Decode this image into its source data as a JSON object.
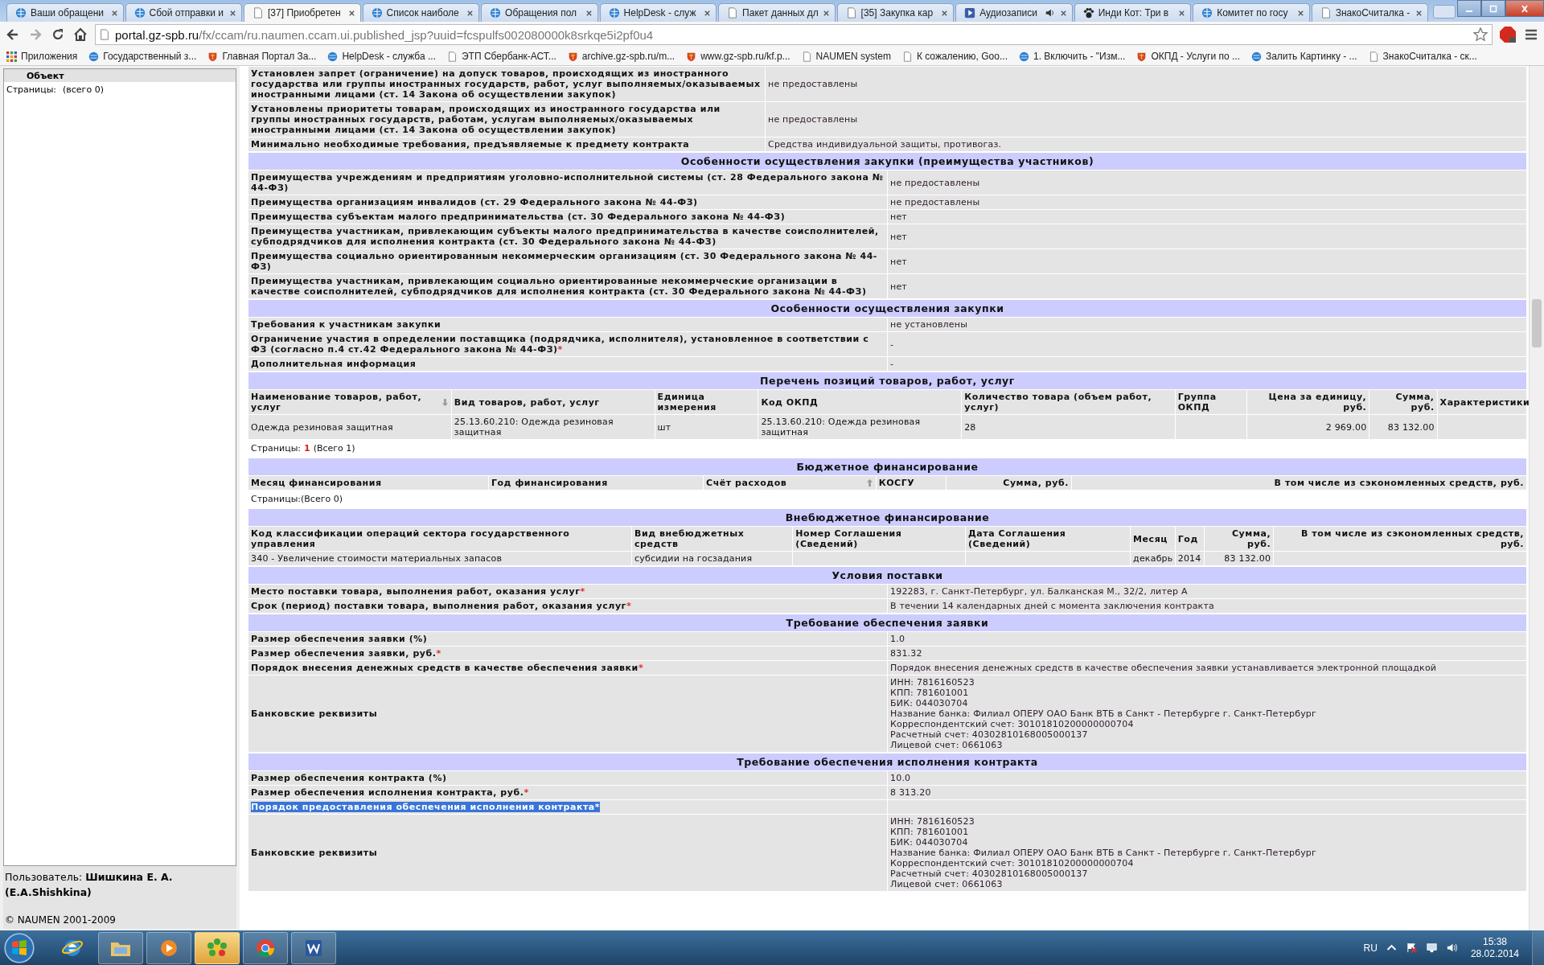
{
  "browser": {
    "tabs": [
      {
        "title": "Ваши обращени",
        "selected": false,
        "playing": false
      },
      {
        "title": "Сбой отправки и",
        "selected": false,
        "playing": false
      },
      {
        "title": "[37] Приобретен",
        "selected": true,
        "playing": false
      },
      {
        "title": "Список наиболе",
        "selected": false,
        "playing": false
      },
      {
        "title": "Обращения пол",
        "selected": false,
        "playing": false
      },
      {
        "title": "HelpDesk - служ",
        "selected": false,
        "playing": false
      },
      {
        "title": "Пакет данных дл",
        "selected": false,
        "playing": false
      },
      {
        "title": "[35] Закупка кар",
        "selected": false,
        "playing": false
      },
      {
        "title": "Аудиозаписи",
        "selected": false,
        "playing": true
      },
      {
        "title": "Инди Кот: Три в",
        "selected": false,
        "playing": false
      },
      {
        "title": "Комитет по госу",
        "selected": false,
        "playing": false
      },
      {
        "title": "ЗнакоСчиталка -",
        "selected": false,
        "playing": false
      }
    ],
    "url_host": "portal.gz-spb.ru",
    "url_path": "/fx/ccam/ru.naumen.ccam.ui.published_jsp?uuid=fcspulfs002080000k8srkqe5i2pf0u4",
    "bookmarks": [
      "Приложения",
      "Государственный з...",
      "Главная Портал За...",
      "HelpDesk - служба ...",
      "ЭТП Сбербанк-АСТ...",
      "archive.gz-spb.ru/m...",
      "www.gz-spb.ru/kf.p...",
      "NAUMEN system",
      "К сожалению, Goo...",
      "1. Включить - \"Изм...",
      "ОКПД - Услуги по ...",
      "Залить Картинку - ...",
      "ЗнакоСчиталка - ск..."
    ]
  },
  "sidebar": {
    "column": "Объект",
    "pages_label": "Страницы:",
    "pages_total": "(всего 0)",
    "user": "Пользователь: **Шишкина Е. А. (E.A.Shishkina)**",
    "copyright": "© NAUMEN 2001-2009"
  },
  "sections": [
    {
      "kind": "form",
      "rows": [
        {
          "label": "Установлен запрет (ограничение) на допуск товаров, происходящих из иностранного государства или группы иностранных государств, работ, услуг выполняемых/оказываемых иностранными лицами (ст. 14 Закона об осуществлении закупок)",
          "value": "не предоставлены",
          "highlighted": false
        },
        {
          "label": "Установлены приоритеты товарам, происходящих из иностранного государства или группы иностранных государств, работам, услугам выполняемых/оказываемых иностранными лицами (ст. 14 Закона об осуществлении закупок)",
          "value": "не предоставлены",
          "highlighted": false
        },
        {
          "label": "Минимально необходимые требования, предъявляемые к предмету контракта",
          "value": "Средства индивидуальной защиты, противогаз.",
          "highlighted": false
        }
      ]
    },
    {
      "kind": "form",
      "title": "Особенности осуществления закупки (преимущества участников)",
      "rows": [
        {
          "label": "Преимущества учреждениям и предприятиям уголовно-исполнительной системы (ст. 28 Федерального закона № 44-ФЗ)",
          "value": "не предоставлены",
          "highlighted": false
        },
        {
          "label": "Преимущества организациям инвалидов (ст. 29 Федерального закона № 44-ФЗ)",
          "value": "не предоставлены",
          "highlighted": false
        },
        {
          "label": "Преимущества субъектам малого предпринимательства (ст. 30 Федерального закона № 44-ФЗ)",
          "value": "нет",
          "highlighted": false
        },
        {
          "label": "Преимущества участникам, привлекающим субъекты малого предпринимательства в качестве соисполнителей, субподрядчиков для исполнения контракта (ст. 30 Федерального закона № 44-ФЗ)",
          "value": "нет",
          "highlighted": false
        },
        {
          "label": "Преимущества социально ориентированным некоммерческим организациям (ст. 30 Федерального закона № 44-ФЗ)",
          "value": "нет",
          "highlighted": false
        },
        {
          "label": "Преимущества участникам, привлекающим социально ориентированные некоммерческие организации в качестве соисполнителей, субподрядчиков для исполнения контракта (ст. 30 Федерального закона № 44-ФЗ)",
          "value": "нет",
          "highlighted": false
        }
      ]
    },
    {
      "kind": "form",
      "title": "Особенности осуществления закупки",
      "rows": [
        {
          "label": "Требования к участникам закупки",
          "value": "не установлены",
          "highlighted": false
        },
        {
          "label": "Ограничение участия в определении поставщика (подрядчика, исполнителя), установленное в соответствии с ФЗ (согласно п.4 ст.42 Федерального закона № 44-ФЗ)",
          "marker": "*",
          "value": "-",
          "highlighted": false
        },
        {
          "label": "Дополнительная информация",
          "value": "-",
          "highlighted": false
        }
      ]
    },
    {
      "kind": "table",
      "title": "Перечень позиций товаров, работ, услуг",
      "columns": [
        {
          "label": "Наименование товаров, работ, услуг",
          "sorted": true,
          "ascending": false,
          "numeric": false
        },
        {
          "label": "Вид товаров, работ, услуг",
          "sorted": false,
          "numeric": false
        },
        {
          "label": "Единица измерения",
          "sorted": false,
          "numeric": false
        },
        {
          "label": "Код ОКПД",
          "sorted": false,
          "numeric": false
        },
        {
          "label": "Количество товара (объем работ, услуг)",
          "sorted": false,
          "numeric": false
        },
        {
          "label": "Группа ОКПД",
          "sorted": false,
          "numeric": false
        },
        {
          "label": "Цена за единицу, руб.",
          "sorted": false,
          "numeric": true
        },
        {
          "label": "Сумма, руб.",
          "sorted": false,
          "numeric": true
        },
        {
          "label": "Характеристики",
          "sorted": false,
          "numeric": false
        }
      ],
      "rows": [
        [
          "Одежда резиновая защитная",
          "25.13.60.210: Одежда резиновая защитная",
          "шт",
          "25.13.60.210: Одежда резиновая защитная",
          "28",
          null,
          "2 969.00",
          "83 132.00",
          null
        ]
      ],
      "pager": {
        "label": "Страницы:",
        "current": "1",
        "total": "(Всего 1)"
      }
    },
    {
      "kind": "table",
      "title": "Бюджетное финансирование",
      "columns": [
        {
          "label": "Месяц финансирования",
          "sorted": false,
          "numeric": false
        },
        {
          "label": "Год финансирования",
          "sorted": false,
          "numeric": false
        },
        {
          "label": "Счёт расходов",
          "sorted": true,
          "ascending": true,
          "numeric": false
        },
        {
          "label": "КОСГУ",
          "sorted": false,
          "numeric": false
        },
        {
          "label": "Сумма, руб.",
          "sorted": false,
          "numeric": true
        },
        {
          "label": "В том числе из сэкономленных средств, руб.",
          "sorted": false,
          "numeric": true
        }
      ],
      "pager": {
        "label": "Страницы:",
        "total": "(Всего 0)"
      }
    },
    {
      "kind": "table",
      "title": "Внебюджетное финансирование",
      "columns": [
        {
          "label": "Код классификации операций сектора государственного управления",
          "sorted": false,
          "numeric": false
        },
        {
          "label": "Вид внебюджетных средств",
          "sorted": false,
          "numeric": false
        },
        {
          "label": "Номер Соглашения (Сведений)",
          "sorted": false,
          "numeric": false
        },
        {
          "label": "Дата Соглашения (Сведений)",
          "sorted": false,
          "numeric": false
        },
        {
          "label": "Месяц",
          "sorted": false,
          "numeric": false
        },
        {
          "label": "Год",
          "sorted": false,
          "numeric": false
        },
        {
          "label": "Сумма, руб.",
          "sorted": false,
          "numeric": true
        },
        {
          "label": "В том числе из сэкономленных средств, руб.",
          "sorted": false,
          "numeric": true
        }
      ],
      "rows": [
        [
          "340 - Увеличение стоимости материальных запасов",
          "субсидии на госзадания",
          null,
          null,
          "декабрь",
          "2014",
          "83 132.00",
          null
        ]
      ]
    },
    {
      "kind": "terms",
      "title": "Условия поставки",
      "rows": [
        {
          "label": "Место поставки товара, выполнения работ, оказания услуг",
          "marker": "*",
          "value": "192283, г. Санкт-Петербург, ул. Балканская М., 32/2, литер А",
          "highlighted": false
        },
        {
          "label": "Срок (период) поставки товара, выполнения работ, оказания услуг",
          "marker": "*",
          "value": "В течении 14 календарных дней с момента заключения контракта",
          "highlighted": false
        }
      ]
    },
    {
      "kind": "terms",
      "title": "Требование обеспечения заявки",
      "rows": [
        {
          "label": "Размер обеспечения заявки (%)",
          "value": "1.0",
          "highlighted": false
        },
        {
          "label": "Размер обеспечения заявки, руб.",
          "marker": "*",
          "value": "831.32",
          "highlighted": false
        },
        {
          "label": "Порядок внесения денежных средств в качестве обеспечения заявки",
          "marker": "*",
          "value": "Порядок внесения денежных средств в качестве обеспечения заявки устанавливается электронной площадкой",
          "highlighted": false
        },
        {
          "label": "Банковские реквизиты",
          "lines": [
            "ИНН: 7816160523",
            "КПП: 781601001",
            "БИК: 044030704",
            "Название банка: Филиал ОПЕРУ ОАО Банк ВТБ в Санкт - Петербурге г. Санкт-Петербург",
            "Корреспондентский счет: 30101810200000000704",
            "Расчетный счет: 40302810168005000137",
            "Лицевой счет: 0661063"
          ],
          "highlighted": false
        }
      ]
    },
    {
      "kind": "terms",
      "title": "Требование обеспечения исполнения контракта",
      "rows": [
        {
          "label": "Размер обеспечения контракта (%)",
          "value": "10.0",
          "highlighted": false
        },
        {
          "label": "Размер обеспечения исполнения контракта, руб.",
          "marker": "*",
          "value": "8 313.20",
          "highlighted": false
        },
        {
          "label": "Порядок предоставления обеспечения исполнения контракта",
          "marker": "*",
          "highlighted": true
        },
        {
          "label": "Банковские реквизиты",
          "lines": [
            "ИНН: 7816160523",
            "КПП: 781601001",
            "БИК: 044030704",
            "Название банка: Филиал ОПЕРУ ОАО Банк ВТБ в Санкт - Петербурге г. Санкт-Петербург",
            "Корреспондентский счет: 30101810200000000704",
            "Расчетный счет: 40302810168005000137",
            "Лицевой счет: 0661063"
          ],
          "highlighted": false
        }
      ]
    }
  ],
  "taskbar": {
    "apps": [
      {
        "running": false,
        "flashing": false
      },
      {
        "running": true,
        "flashing": false
      },
      {
        "running": true,
        "flashing": false
      },
      {
        "running": true,
        "flashing": true
      },
      {
        "running": true,
        "flashing": false
      },
      {
        "running": true,
        "flashing": false
      }
    ],
    "language": "RU",
    "time": "15:38",
    "date": "28.02.2014"
  }
}
